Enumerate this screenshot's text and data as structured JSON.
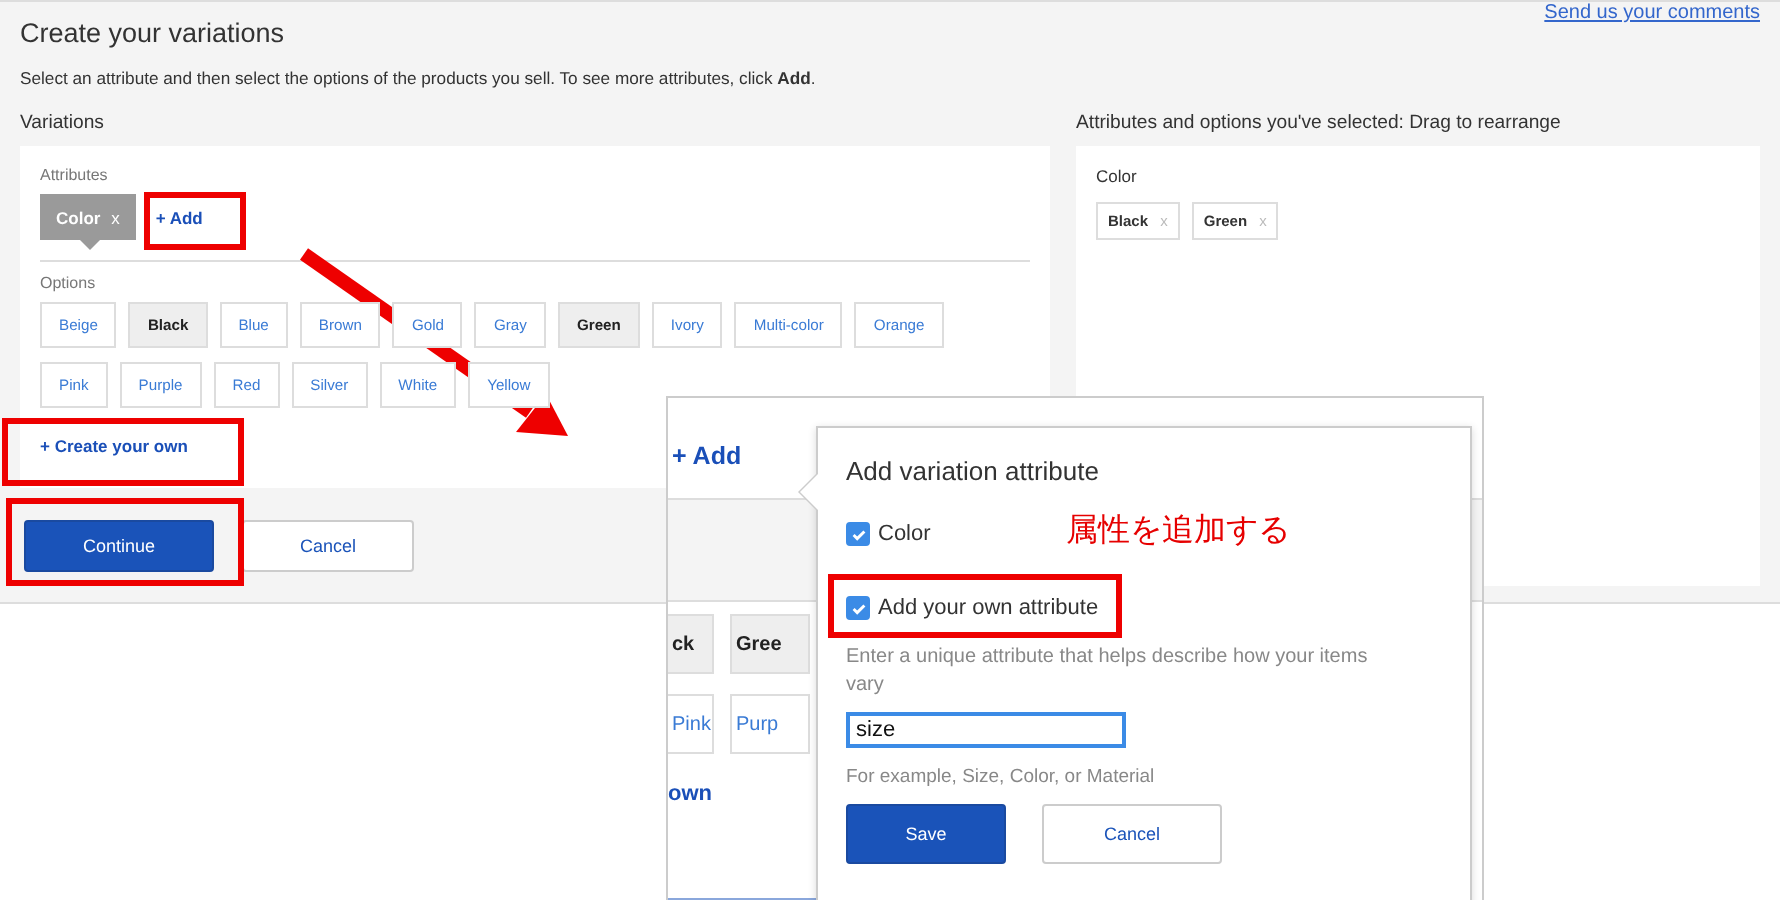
{
  "page": {
    "title": "Create your variations",
    "feedback_link": "Send us your comments",
    "instructions": "Select an attribute and then select the options of the products you sell. To see more attributes, click **Add**."
  },
  "variations": {
    "heading": "Variations",
    "attributes_label": "Attributes",
    "attributes": [
      {
        "label": "Color",
        "remove": "x",
        "selected": true
      }
    ],
    "add_link": "+ Add",
    "options_label": "Options",
    "options": [
      {
        "label": "Beige",
        "selected": false
      },
      {
        "label": "Black",
        "selected": true
      },
      {
        "label": "Blue",
        "selected": false
      },
      {
        "label": "Brown",
        "selected": false
      },
      {
        "label": "Gold",
        "selected": false
      },
      {
        "label": "Gray",
        "selected": false
      },
      {
        "label": "Green",
        "selected": true
      },
      {
        "label": "Ivory",
        "selected": false
      },
      {
        "label": "Multi-color",
        "selected": false
      },
      {
        "label": "Orange",
        "selected": false
      },
      {
        "label": "Pink",
        "selected": false
      },
      {
        "label": "Purple",
        "selected": false
      },
      {
        "label": "Red",
        "selected": false
      },
      {
        "label": "Silver",
        "selected": false
      },
      {
        "label": "White",
        "selected": false
      },
      {
        "label": "Yellow",
        "selected": false
      }
    ],
    "create_link": "+ Create your own"
  },
  "selected_panel": {
    "heading": "Attributes and options you've selected: Drag to rearrange",
    "groups": [
      {
        "name": "Color",
        "values": [
          {
            "label": "Black",
            "remove": "x"
          },
          {
            "label": "Green",
            "remove": "x"
          }
        ]
      }
    ]
  },
  "buttons": [
    {
      "label": "Continue",
      "kind": "primary"
    },
    {
      "label": "Cancel",
      "kind": "secondary"
    }
  ],
  "inset": {
    "add_link": "+ Add",
    "chips": [
      {
        "label": "ck",
        "selected": true
      },
      {
        "label": "Gree",
        "selected": true
      },
      {
        "label": "Pink",
        "selected": false
      },
      {
        "label": "Purp",
        "selected": false
      }
    ],
    "create_link": "own",
    "popup": {
      "title": "Add variation attribute",
      "checkboxes": [
        {
          "label": "Color",
          "checked": true
        },
        {
          "label": "Add your own attribute",
          "checked": true
        }
      ],
      "hint": "Enter a unique attribute that helps describe how your items vary",
      "value": "size",
      "example": "For example, Size, Color, or Material",
      "buttons": [
        {
          "label": "Save",
          "kind": "primary"
        },
        {
          "label": "Cancel",
          "kind": "secondary"
        }
      ]
    }
  },
  "annotation": {
    "note": "属性を追加する"
  }
}
